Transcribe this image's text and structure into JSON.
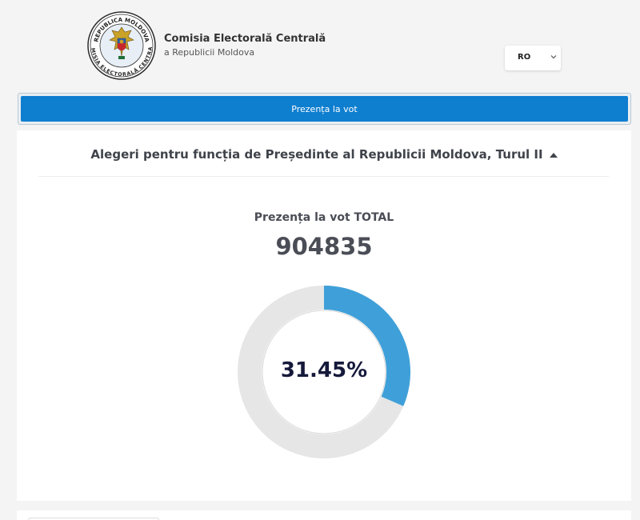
{
  "header": {
    "org_name": "Comisia Electorală Centrală",
    "org_sub": "a Republicii Moldova",
    "seal_top_text": "REPUBLICA MOLDOVA",
    "seal_bottom_text": "COMISIA ELECTORALĂ CENTRALĂ",
    "language": "RO"
  },
  "nav": {
    "active_tab": "Prezența la vot"
  },
  "election": {
    "title": "Alegeri pentru funcția de Președinte al Republicii Moldova, Turul II",
    "turnout_heading": "Prezența la vot TOTAL",
    "turnout_total": "904835",
    "turnout_percent_label": "31.45%",
    "turnout_percent": 31.45
  },
  "colors": {
    "accent": "#0e7ecf",
    "donut_fill": "#3fa0d9",
    "donut_track": "#e6e6e6"
  }
}
